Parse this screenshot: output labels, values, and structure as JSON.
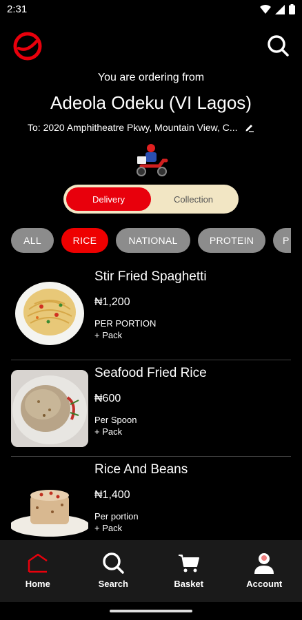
{
  "status_bar": {
    "time": "2:31"
  },
  "header": {
    "logo_icon": "brand-logo-icon",
    "search_icon": "search-icon"
  },
  "order_info": {
    "ordering_from": "You are ordering from",
    "restaurant": "Adeola Odeku (VI Lagos)",
    "address": "To: 2020 Amphitheatre Pkwy, Mountain View, C..."
  },
  "mode": {
    "options": [
      "Delivery",
      "Collection"
    ],
    "selected": "Delivery"
  },
  "categories": {
    "items": [
      "ALL",
      "RICE",
      "NATIONAL",
      "PROTEIN",
      "P"
    ],
    "selected": "RICE"
  },
  "menu": {
    "items": [
      {
        "name": "Stir Fried Spaghetti",
        "price": "₦1,200",
        "portion": "PER PORTION",
        "pack": "+ Pack"
      },
      {
        "name": "Seafood Fried Rice",
        "price": "₦600",
        "portion": "Per Spoon",
        "pack": "+ Pack"
      },
      {
        "name": "Rice And Beans",
        "price": "₦1,400",
        "portion": "Per portion",
        "pack": "+ Pack"
      }
    ]
  },
  "bottom_nav": {
    "items": [
      {
        "label": "Home",
        "icon": "home-icon"
      },
      {
        "label": "Search",
        "icon": "search-icon"
      },
      {
        "label": "Basket",
        "icon": "cart-icon"
      },
      {
        "label": "Account",
        "icon": "account-icon"
      }
    ]
  },
  "colors": {
    "accent": "#e8000c",
    "toggle_bg": "#f2e6c4",
    "pill_bg": "#8c8c8c",
    "nav_bg": "#1a1a1a"
  }
}
